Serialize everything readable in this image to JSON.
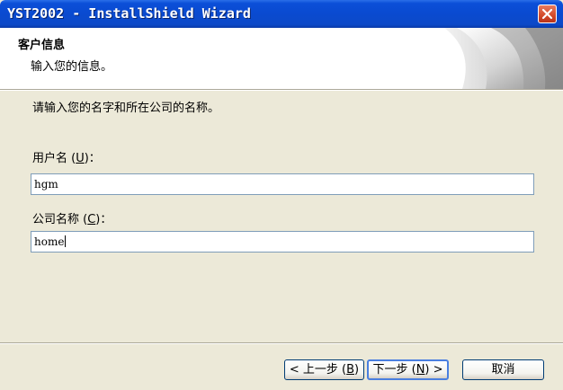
{
  "window": {
    "title": "YST2002 - InstallShield Wizard",
    "close_icon": "close-icon"
  },
  "header": {
    "title": "客户信息",
    "subtitle": "输入您的信息。"
  },
  "body": {
    "instruction": "请输入您的名字和所在公司的名称。",
    "username": {
      "label_pre": "用户名 (",
      "label_key": "U",
      "label_post": ")：",
      "value": "hgm"
    },
    "company": {
      "label_pre": "公司名称 (",
      "label_key": "C",
      "label_post": ")：",
      "value": "home"
    }
  },
  "buttons": {
    "back": {
      "pre": "< 上一步 (",
      "key": "B",
      "post": ")"
    },
    "next": {
      "pre": "下一步 (",
      "key": "N",
      "post": ") >"
    },
    "cancel": {
      "label": "取消"
    }
  },
  "colors": {
    "titlebar": "#0a4ad0",
    "dialog_bg": "#ece9d8",
    "close_button": "#d24a2a"
  }
}
